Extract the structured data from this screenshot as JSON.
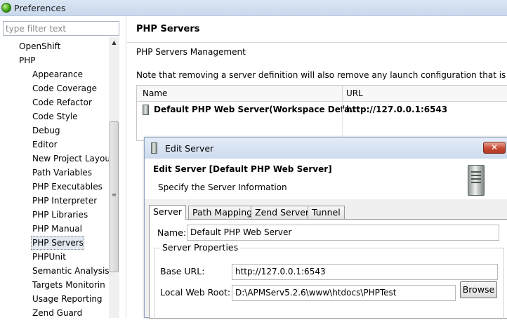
{
  "window": {
    "title": "Preferences"
  },
  "filter": {
    "placeholder": "type filter text"
  },
  "tree": {
    "items": [
      {
        "label": "OpenShift",
        "level": 1
      },
      {
        "label": "PHP",
        "level": 1
      },
      {
        "label": "Appearance",
        "level": 2
      },
      {
        "label": "Code Coverage",
        "level": 2
      },
      {
        "label": "Code Refactor",
        "level": 2
      },
      {
        "label": "Code Style",
        "level": 2
      },
      {
        "label": "Debug",
        "level": 2
      },
      {
        "label": "Editor",
        "level": 2
      },
      {
        "label": "New Project Layou",
        "level": 2
      },
      {
        "label": "Path Variables",
        "level": 2
      },
      {
        "label": "PHP Executables",
        "level": 2
      },
      {
        "label": "PHP Interpreter",
        "level": 2
      },
      {
        "label": "PHP Libraries",
        "level": 2
      },
      {
        "label": "PHP Manual",
        "level": 2
      },
      {
        "label": "PHP Servers",
        "level": 2,
        "selected": true
      },
      {
        "label": "PHPUnit",
        "level": 2
      },
      {
        "label": "Semantic Analysis",
        "level": 2
      },
      {
        "label": "Targets Monitorin",
        "level": 2
      },
      {
        "label": "Usage Reporting",
        "level": 2
      },
      {
        "label": "Zend Guard",
        "level": 2
      }
    ]
  },
  "icons": {
    "scroll_up": "▲",
    "scroll_grip": "≡",
    "close": "✕"
  },
  "page": {
    "title": "PHP Servers",
    "subtitle": "PHP Servers Management",
    "note": "Note that removing a server definition will also remove any launch configuration that is usin"
  },
  "servers_table": {
    "columns": [
      "Name",
      "URL"
    ],
    "rows": [
      {
        "name": "Default PHP Web Server(Workspace Defa...",
        "url": "http://127.0.0.1:6543"
      }
    ]
  },
  "dialog": {
    "title": "Edit Server",
    "heading": "Edit Server [Default PHP Web Server]",
    "description": "Specify the Server Information",
    "tabs": [
      "Server",
      "Path Mapping",
      "Zend Server",
      "Tunnel"
    ],
    "active_tab": "Server",
    "name_label": "Name:",
    "name_value": "Default PHP Web Server",
    "group_label": "Server Properties",
    "base_url_label": "Base URL:",
    "base_url_value": "http://127.0.0.1:6543",
    "docroot_label": "Local Web Root:",
    "docroot_value": "D:\\APMServ5.2.6\\www\\htdocs\\PHPTest",
    "browse_label": "Browse"
  }
}
